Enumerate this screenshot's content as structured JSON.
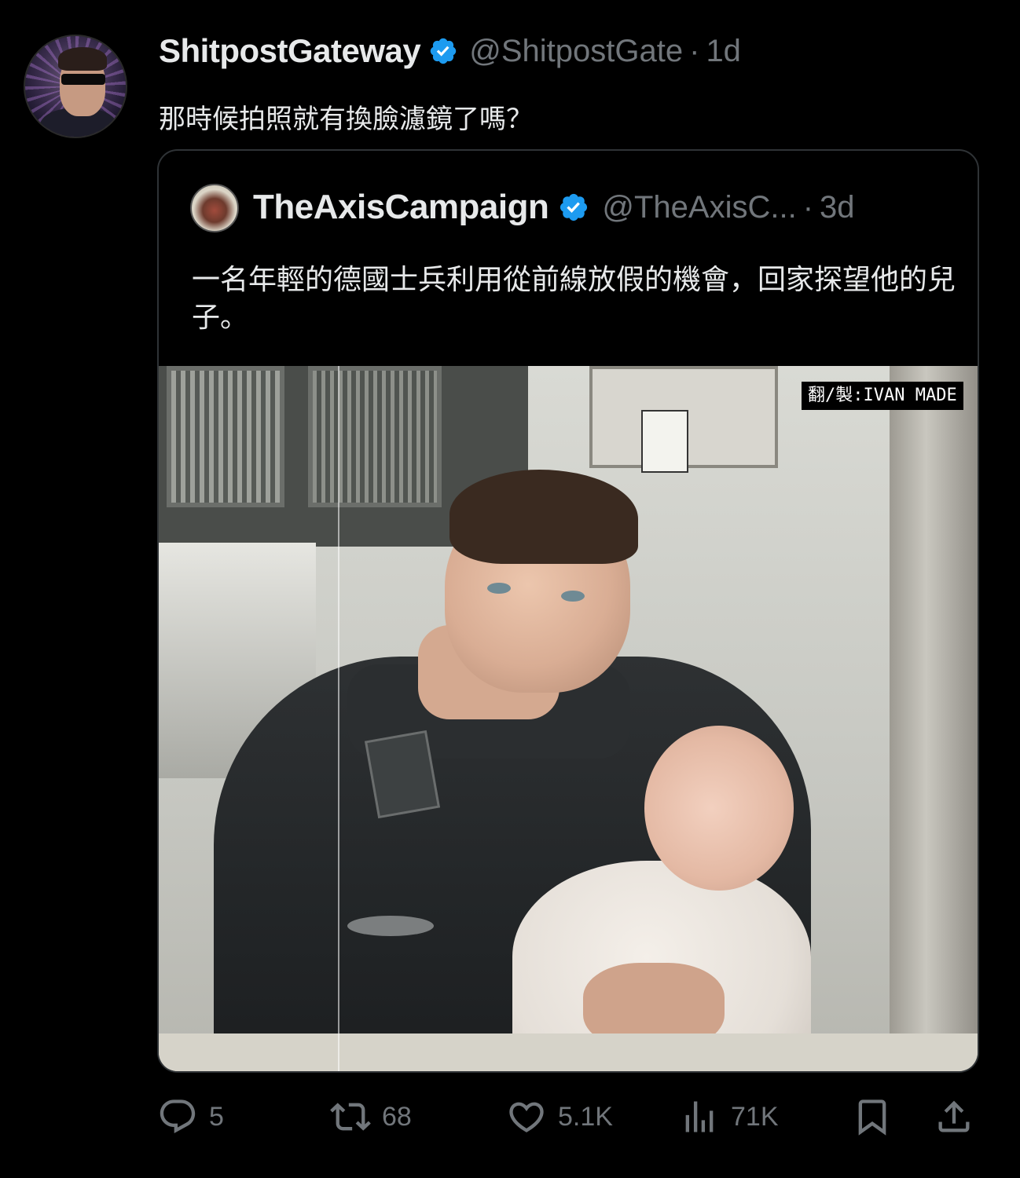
{
  "tweet": {
    "display_name": "ShitpostGateway",
    "handle": "@ShitpostGate",
    "separator": "·",
    "time": "1d",
    "text": "那時候拍照就有換臉濾鏡了嗎？",
    "avatar_icon": "user-avatar"
  },
  "quoted": {
    "display_name": "TheAxisCampaign",
    "handle": "@TheAxisC...",
    "separator": "·",
    "time": "3d",
    "text": "一名年輕的德國士兵利用從前線放假的機會，回家探望他的兒子。",
    "avatar_icon": "quoted-user-avatar",
    "image": {
      "watermark": "翻/製:IVAN MADE",
      "description_icon": "photo"
    }
  },
  "actions": {
    "reply": {
      "icon": "reply-icon",
      "count": "5"
    },
    "retweet": {
      "icon": "retweet-icon",
      "count": "68"
    },
    "like": {
      "icon": "heart-icon",
      "count": "5.1K"
    },
    "views": {
      "icon": "views-icon",
      "count": "71K"
    },
    "bookmark": {
      "icon": "bookmark-icon"
    },
    "share": {
      "icon": "share-icon"
    }
  },
  "colors": {
    "background": "#000000",
    "text_primary": "#e7e9ea",
    "text_secondary": "#71767b",
    "verified": "#1d9bf0",
    "border": "#2f3336"
  }
}
